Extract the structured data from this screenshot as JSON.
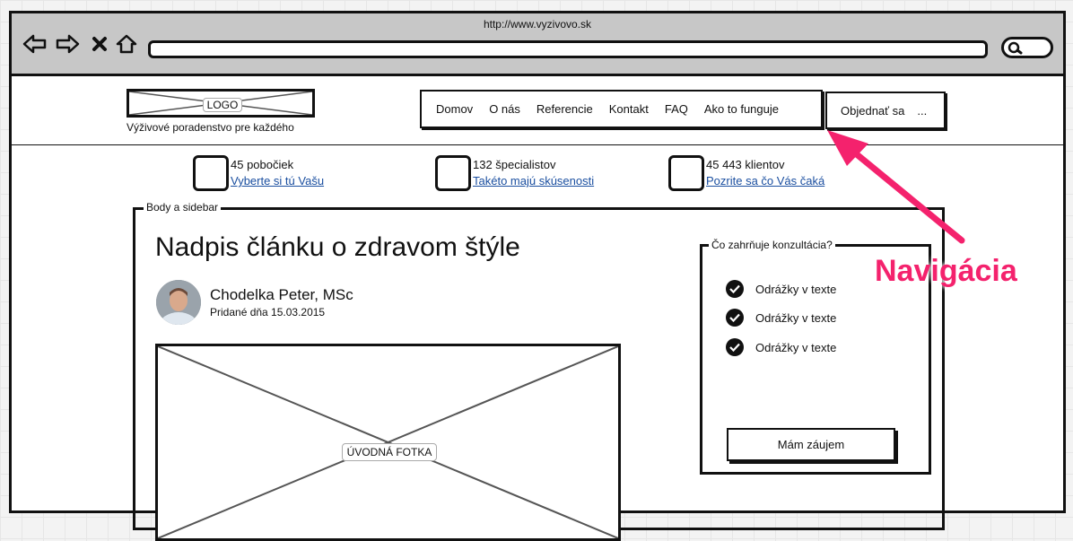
{
  "browser": {
    "url": "http://www.vyzivovo.sk",
    "icons": [
      "back-icon",
      "forward-icon",
      "close-icon",
      "home-icon",
      "search-icon"
    ]
  },
  "header": {
    "logo_label": "LOGO",
    "tagline": "Výživové poradenstvo pre každého",
    "nav": [
      "Domov",
      "O nás",
      "Referencie",
      "Kontakt",
      "FAQ",
      "Ako to funguje"
    ],
    "order_label": "Objednať sa",
    "order_more": "..."
  },
  "stats": [
    {
      "title": "45 pobočiek",
      "link": "Vyberte si tú Vašu"
    },
    {
      "title": "132 špecialistov",
      "link": "Takéto majú skúsenosti"
    },
    {
      "title": "45 443 klientov",
      "link": "Pozrite sa čo Vás čaká"
    }
  ],
  "body": {
    "legend": "Body a sidebar",
    "headline": "Nadpis článku o zdravom štýle",
    "author": "Chodelka Peter, MSc",
    "date": "Pridané dňa 15.03.2015",
    "photo_label": "ÚVODNÁ FOTKA"
  },
  "sidebar": {
    "legend": "Čo zahrňuje konzultácia?",
    "bullets": [
      "Odrážky v texte",
      "Odrážky v texte",
      "Odrážky v texte"
    ],
    "cta": "Mám záujem"
  },
  "annotation": {
    "label": "Navigácia",
    "color": "#f4226d"
  }
}
